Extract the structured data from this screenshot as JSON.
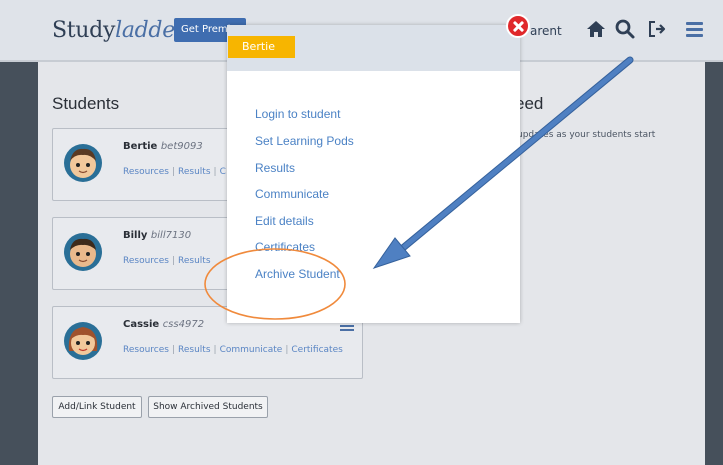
{
  "header": {
    "logo_main": "Study",
    "logo_accent": "ladder",
    "premium_label": "Get Premium",
    "parent_label": "arent"
  },
  "main": {
    "students_title": "Students",
    "feed_title": "eed",
    "feed_text": "updates as your students start"
  },
  "students": [
    {
      "name": "Bertie",
      "code": "bet9093",
      "links": [
        "Resources",
        "Results",
        "C"
      ]
    },
    {
      "name": "Billy",
      "code": "bill7130",
      "links": [
        "Resources",
        "Results",
        ""
      ]
    },
    {
      "name": "Cassie",
      "code": "css4972",
      "links": [
        "Resources",
        "Results",
        "Communicate",
        "Certificates"
      ]
    }
  ],
  "buttons": {
    "add_link": "Add/Link Student",
    "show_archived": "Show Archived Students"
  },
  "modal": {
    "student_tag": "Bertie",
    "items": [
      "Login to student",
      "Set Learning Pods",
      "Results",
      "Communicate",
      "Edit details",
      "Certificates",
      "Archive Student"
    ]
  },
  "colors": {
    "brand_blue": "#3f6db0",
    "link_blue": "#4b82c5",
    "tag_yellow": "#f7b500",
    "close_red": "#e0282b",
    "annotation_orange": "#f08a3c",
    "arrow_blue": "#4f80c2"
  },
  "icons": [
    "home-icon",
    "search-icon",
    "logout-icon",
    "hamburger-menu-icon",
    "close-icon"
  ]
}
